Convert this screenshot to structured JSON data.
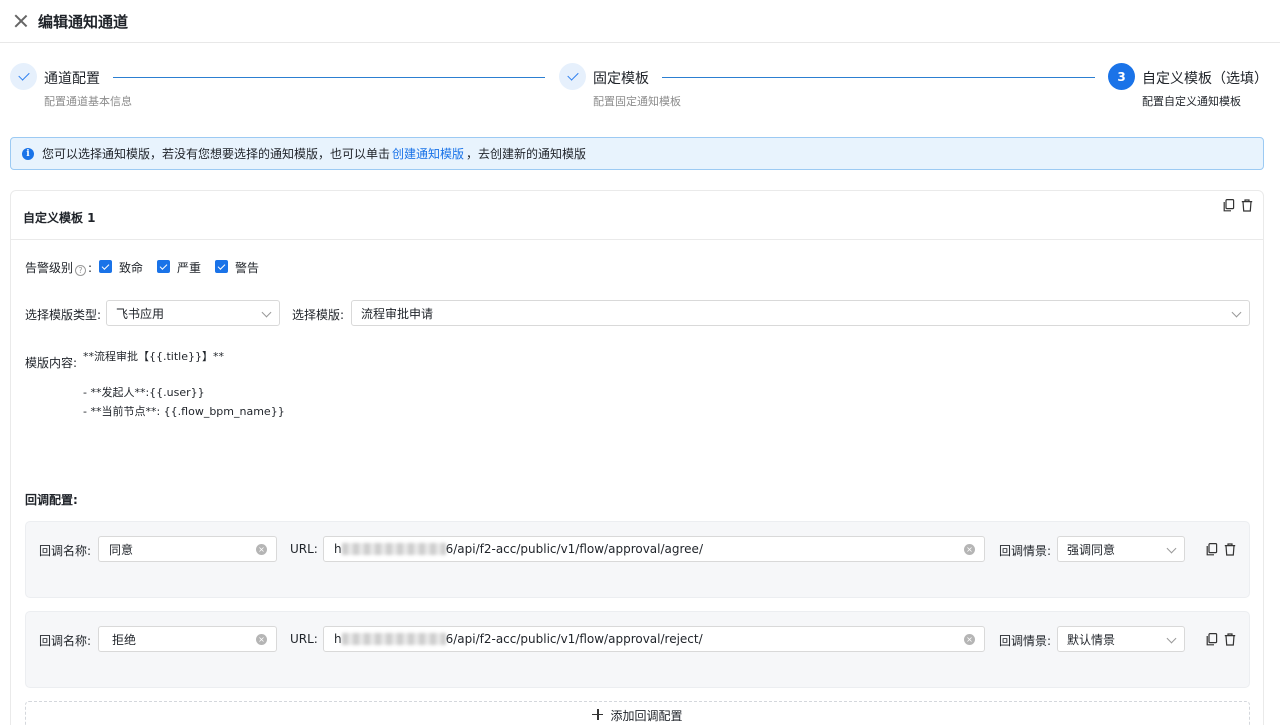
{
  "header": {
    "title": "编辑通知通道"
  },
  "steps": [
    {
      "title": "通道配置",
      "subtitle": "配置通道基本信息",
      "status": "done"
    },
    {
      "title": "固定模板",
      "subtitle": "配置固定通知模板",
      "status": "done"
    },
    {
      "number": "3",
      "title": "自定义模板（选填）",
      "subtitle": "配置自定义通知模板",
      "status": "active"
    }
  ],
  "alert": {
    "prefix": "您可以选择通知模版，若没有您想要选择的通知模版，也可以单击",
    "link": "创建通知模版",
    "suffix": "，去创建新的通知模版"
  },
  "card": {
    "title": "自定义模板 1",
    "alert_level_label": "告警级别",
    "alert_level_suffix": ":",
    "levels": [
      "致命",
      "严重",
      "警告"
    ],
    "template_type_label": "选择模版类型:",
    "template_type_value": "飞书应用",
    "template_label": "选择模版:",
    "template_value": "流程审批申请",
    "content_label": "模版内容:",
    "content_lines": [
      "**流程审批【{{.title}}】**",
      "",
      "- **发起人**:{{.user}}",
      "- **当前节点**: {{.flow_bpm_name}}"
    ],
    "callback_section_label": "回调配置:",
    "callbacks": [
      {
        "name_label": "回调名称:",
        "name": "同意",
        "url_label": "URL:",
        "url_prefix": "h",
        "url_suffix": "6/api/f2-acc/public/v1/flow/approval/agree/",
        "scene_label": "回调情景:",
        "scene": "强调同意"
      },
      {
        "name_label": "回调名称:",
        "name": "拒绝",
        "url_label": "URL:",
        "url_prefix": "h",
        "url_suffix": "6/api/f2-acc/public/v1/flow/approval/reject/",
        "scene_label": "回调情景:",
        "scene": "默认情景"
      }
    ],
    "add_callback_label": "添加回调配置"
  },
  "colors": {
    "primary": "#1a73e8",
    "alert_bg": "#e8f3fd",
    "step_line": "#2c7fd1"
  }
}
